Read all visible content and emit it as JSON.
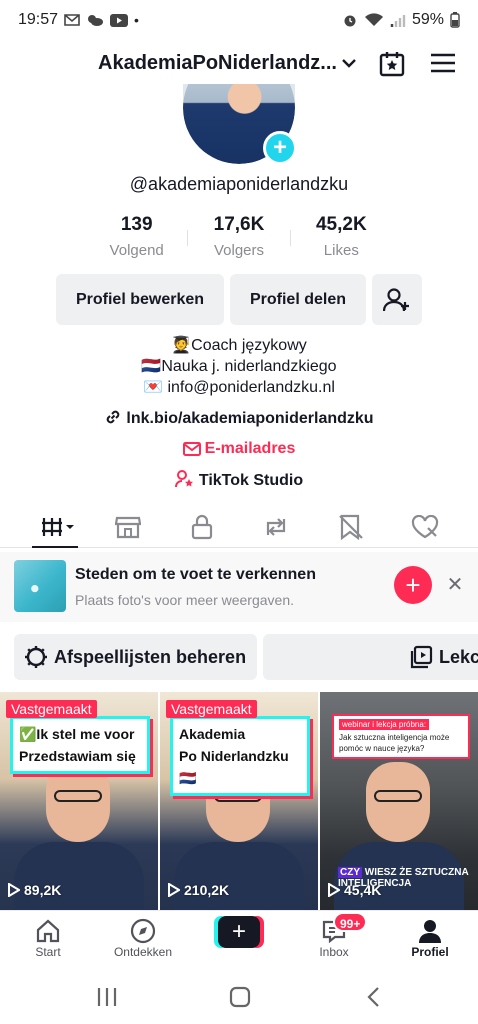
{
  "status_bar": {
    "time": "19:57",
    "battery": "59%"
  },
  "header": {
    "title": "AkademiaPoNiderlandz..."
  },
  "profile": {
    "username": "@akademiaponiderlandzku",
    "stats": [
      {
        "value": "139",
        "label": "Volgend"
      },
      {
        "value": "17,6K",
        "label": "Volgers"
      },
      {
        "value": "45,2K",
        "label": "Likes"
      }
    ],
    "edit_label": "Profiel bewerken",
    "share_label": "Profiel delen",
    "bio_lines": [
      "🧑‍🎓Coach językowy",
      "🇳🇱Nauka j. niderlandzkiego",
      "💌 info@poniderlandzku.nl"
    ],
    "link": "lnk.bio/akademiaponiderlandzku",
    "email_label": "E-mailadres",
    "studio_label": "TikTok Studio"
  },
  "suggestion": {
    "title": "Steden om te voet te verkennen",
    "subtitle": "Plaats foto's voor meer weergaven."
  },
  "chips": {
    "playlists": "Afspeellijsten beheren",
    "lessons": "Lekc"
  },
  "videos": [
    {
      "pinned": "Vastgemaakt",
      "caption_lines": [
        "✅Ik stel me voor",
        "Przedstawiam się"
      ],
      "views": "89,2K"
    },
    {
      "pinned": "Vastgemaakt",
      "caption_lines": [
        "Akademia",
        "Po Niderlandzku🇳🇱"
      ],
      "views": "210,2K"
    },
    {
      "caption_head": "webinar i lekcja próbna:",
      "caption_body": "Jak sztuczna inteligencja może pomóc w nauce języka?",
      "overlay_hl": "CZY",
      "overlay_text": "WIESZ ŻE SZTUCZNA INTELIGENCJA",
      "views": "45,4K"
    }
  ],
  "bottom_nav": {
    "items": [
      "Start",
      "Ontdekken",
      "Inbox",
      "Profiel"
    ],
    "inbox_badge": "99+"
  },
  "colors": {
    "accent": "#fe2c55",
    "cyan": "#25f4ee",
    "text": "#161823",
    "muted": "#8a8b91"
  }
}
